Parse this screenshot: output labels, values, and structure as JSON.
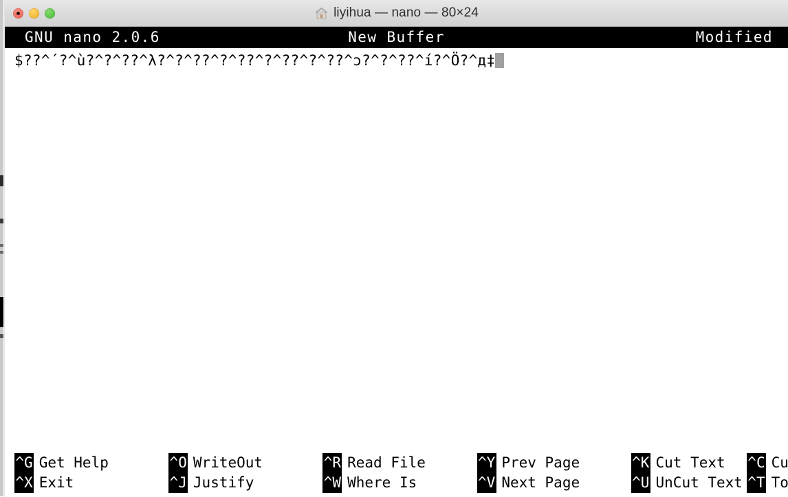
{
  "window": {
    "title": "liyihua — nano — 80×24",
    "icon": "home-icon",
    "traffic_lights": [
      {
        "name": "close-button",
        "color": "#ef6f62"
      },
      {
        "name": "minimize-button",
        "color": "#f6bc3e"
      },
      {
        "name": "zoom-button",
        "color": "#5fc74b"
      }
    ]
  },
  "nano": {
    "version": "GNU nano 2.0.6",
    "buffer_name": "New Buffer",
    "status": "Modified",
    "buffer_lines": [
      "$??^´?^ù?^?^??^λ?^?^??^?^??^?^??^?^??^ɔ?^?^??^í?^Ö?^д‡"
    ],
    "cursor": {
      "glyph": "block",
      "color": "#a0a0a0"
    }
  },
  "shortcuts": {
    "row1": [
      {
        "key": "^G",
        "label": "Get Help"
      },
      {
        "key": "^O",
        "label": "WriteOut"
      },
      {
        "key": "^R",
        "label": "Read File"
      },
      {
        "key": "^Y",
        "label": "Prev Page"
      },
      {
        "key": "^K",
        "label": "Cut Text"
      },
      {
        "key": "^C",
        "label": "Cur Pos"
      }
    ],
    "row2": [
      {
        "key": "^X",
        "label": "Exit"
      },
      {
        "key": "^J",
        "label": "Justify"
      },
      {
        "key": "^W",
        "label": "Where Is"
      },
      {
        "key": "^V",
        "label": "Next Page"
      },
      {
        "key": "^U",
        "label": "UnCut Text"
      },
      {
        "key": "^T",
        "label": "To Spell"
      }
    ]
  },
  "colors": {
    "terminal_bg": "#ffffff",
    "terminal_fg": "#000000",
    "inverse_bg": "#000000",
    "inverse_fg": "#ffffff",
    "titlebar_bg": "#dcdcdc",
    "cursor": "#a0a0a0"
  }
}
